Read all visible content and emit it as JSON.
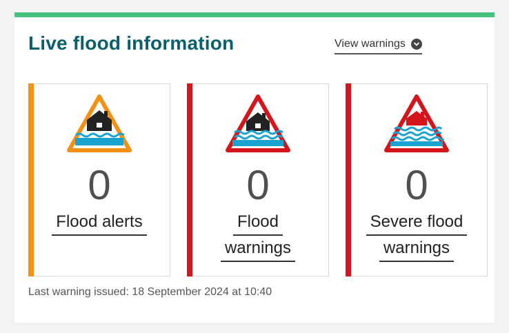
{
  "header": {
    "title": "Live flood information",
    "view_link": "View warnings",
    "accent_color": "#47c17f"
  },
  "cards": [
    {
      "count": "0",
      "label_lines": [
        "Flood alerts"
      ],
      "accent_color": "#f29114",
      "icon": "flood-alert-icon"
    },
    {
      "count": "0",
      "label_lines": [
        "Flood",
        "warnings"
      ],
      "accent_color": "#d4151c",
      "icon": "flood-warning-icon"
    },
    {
      "count": "0",
      "label_lines": [
        "Severe flood",
        "warnings"
      ],
      "accent_color": "#d4151c",
      "icon": "severe-flood-warning-icon"
    }
  ],
  "footer": {
    "last_issued": "Last warning issued: 18 September 2024 at 10:40"
  }
}
